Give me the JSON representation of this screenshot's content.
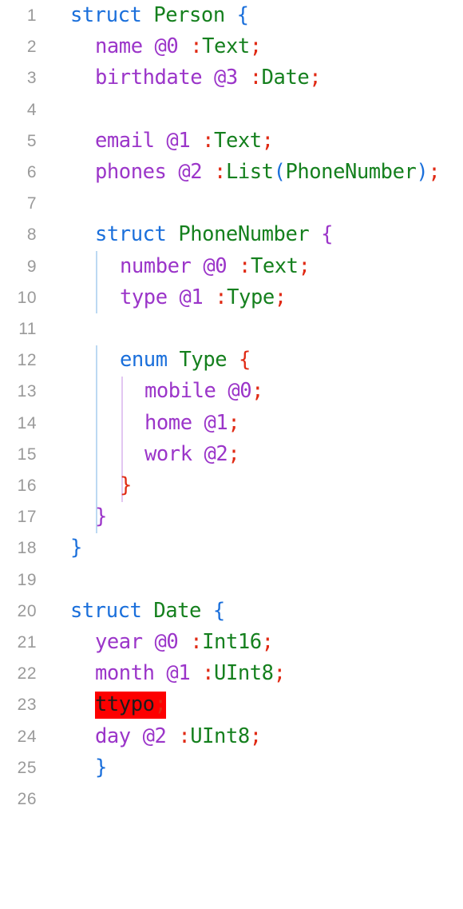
{
  "editor": {
    "background_color": "#ffffff",
    "gutter_text_color": "#9a9a9a",
    "font_size_px": 25.5,
    "line_height_px": 39.2,
    "total_lines": 26,
    "language": "capnp"
  },
  "palette": {
    "keyword": "#1a6fdb",
    "type": "#15801e",
    "field": "#9b35c9",
    "ordinal": "#9b35c9",
    "punctuation": "#e02a14",
    "bracket_depth_0": "#1a6fdb",
    "bracket_depth_1": "#9b35c9",
    "bracket_depth_2": "#e02a14",
    "error_background": "#fd0000",
    "error_text": "#1c1c1c",
    "indent_guide_blue": "#bcd9f2",
    "indent_guide_purple": "#e2c6f2"
  },
  "gutter": {
    "numbers": [
      "1",
      "2",
      "3",
      "4",
      "5",
      "6",
      "7",
      "8",
      "9",
      "10",
      "11",
      "12",
      "13",
      "14",
      "15",
      "16",
      "17",
      "18",
      "19",
      "20",
      "21",
      "22",
      "23",
      "24",
      "25",
      "26"
    ]
  },
  "lines": [
    {
      "n": "1",
      "text": "struct Person {"
    },
    {
      "n": "2",
      "text": "  name @0 :Text;"
    },
    {
      "n": "3",
      "text": "  birthdate @3 :Date;"
    },
    {
      "n": "4",
      "text": ""
    },
    {
      "n": "5",
      "text": "  email @1 :Text;"
    },
    {
      "n": "6",
      "text": "  phones @2 :List(PhoneNumber);"
    },
    {
      "n": "7",
      "text": ""
    },
    {
      "n": "8",
      "text": "  struct PhoneNumber {"
    },
    {
      "n": "9",
      "text": "    number @0 :Text;"
    },
    {
      "n": "10",
      "text": "    type @1 :Type;"
    },
    {
      "n": "11",
      "text": ""
    },
    {
      "n": "12",
      "text": "    enum Type {"
    },
    {
      "n": "13",
      "text": "      mobile @0;"
    },
    {
      "n": "14",
      "text": "      home @1;"
    },
    {
      "n": "15",
      "text": "      work @2;"
    },
    {
      "n": "16",
      "text": "    }"
    },
    {
      "n": "17",
      "text": "  }"
    },
    {
      "n": "18",
      "text": "}"
    },
    {
      "n": "19",
      "text": ""
    },
    {
      "n": "20",
      "text": "struct Date {"
    },
    {
      "n": "21",
      "text": "  year @0 :Int16;"
    },
    {
      "n": "22",
      "text": "  month @1 :UInt8;"
    },
    {
      "n": "23",
      "text": "  ttypo;"
    },
    {
      "n": "24",
      "text": "  day @2 :UInt8;"
    },
    {
      "n": "25",
      "text": "}"
    },
    {
      "n": "26",
      "text": ""
    }
  ],
  "tokens": {
    "l1": {
      "kw": "struct",
      "sp1": " ",
      "name": "Person",
      "sp2": " ",
      "brace": "{"
    },
    "l2": {
      "field": "name",
      "sp1": " ",
      "ord": "@0",
      "sp2": " ",
      "colon": ":",
      "type": "Text",
      "semi": ";"
    },
    "l3": {
      "field": "birthdate",
      "sp1": " ",
      "ord": "@3",
      "sp2": " ",
      "colon": ":",
      "type": "Date",
      "semi": ";"
    },
    "l5": {
      "field": "email",
      "sp1": " ",
      "ord": "@1",
      "sp2": " ",
      "colon": ":",
      "type": "Text",
      "semi": ";"
    },
    "l6": {
      "field": "phones",
      "sp1": " ",
      "ord": "@2",
      "sp2": " ",
      "colon": ":",
      "type": "List",
      "lparen": "(",
      "inner": "PhoneNumber",
      "rparen": ")",
      "semi": ";"
    },
    "l8": {
      "kw": "struct",
      "sp1": " ",
      "name": "PhoneNumber",
      "sp2": " ",
      "brace": "{"
    },
    "l9": {
      "field": "number",
      "sp1": " ",
      "ord": "@0",
      "sp2": " ",
      "colon": ":",
      "type": "Text",
      "semi": ";"
    },
    "l10": {
      "field": "type",
      "sp1": " ",
      "ord": "@1",
      "sp2": " ",
      "colon": ":",
      "type": "Type",
      "semi": ";"
    },
    "l12": {
      "kw": "enum",
      "sp1": " ",
      "name": "Type",
      "sp2": " ",
      "brace": "{"
    },
    "l13": {
      "field": "mobile",
      "sp1": " ",
      "ord": "@0",
      "semi": ";"
    },
    "l14": {
      "field": "home",
      "sp1": " ",
      "ord": "@1",
      "semi": ";"
    },
    "l15": {
      "field": "work",
      "sp1": " ",
      "ord": "@2",
      "semi": ";"
    },
    "l16": {
      "brace": "}"
    },
    "l17": {
      "brace": "}"
    },
    "l18": {
      "brace": "}"
    },
    "l20": {
      "kw": "struct",
      "sp1": " ",
      "name": "Date",
      "sp2": " ",
      "brace": "{"
    },
    "l21": {
      "field": "year",
      "sp1": " ",
      "ord": "@0",
      "sp2": " ",
      "colon": ":",
      "type": "Int16",
      "semi": ";"
    },
    "l22": {
      "field": "month",
      "sp1": " ",
      "ord": "@1",
      "sp2": " ",
      "colon": ":",
      "type": "UInt8",
      "semi": ";"
    },
    "l23": {
      "err": "ttypo",
      "semi": ";"
    },
    "l24": {
      "field": "day",
      "sp1": " ",
      "ord": "@2",
      "sp2": " ",
      "colon": ":",
      "type": "UInt8",
      "semi": ";"
    },
    "l25": {
      "brace": "}"
    }
  }
}
